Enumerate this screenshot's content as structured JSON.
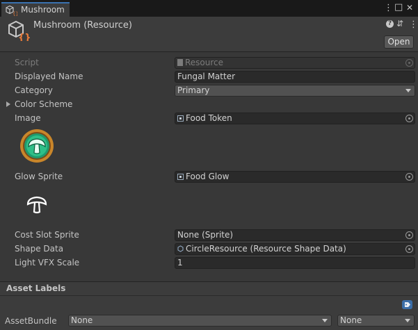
{
  "tab": {
    "title": "Mushroom",
    "icon": "scriptable-object-icon"
  },
  "window_controls": {
    "menu": "⋮",
    "maximize": "□",
    "close": "✕"
  },
  "header": {
    "title": "Mushroom (Resource)",
    "icons": [
      "help-icon",
      "presets-icon",
      "kebab-menu-icon"
    ],
    "help_glyph": "?",
    "presets_glyph": "⇵",
    "kebab_glyph": "⋮",
    "open_label": "Open"
  },
  "fields": {
    "script": {
      "label": "Script",
      "value": "Resource"
    },
    "displayed_name": {
      "label": "Displayed Name",
      "value": "Fungal Matter"
    },
    "category": {
      "label": "Category",
      "value": "Primary"
    },
    "color_scheme": {
      "label": "Color Scheme"
    },
    "image": {
      "label": "Image",
      "value": "Food Token"
    },
    "glow_sprite": {
      "label": "Glow Sprite",
      "value": "Food Glow"
    },
    "cost_slot_sprite": {
      "label": "Cost Slot Sprite",
      "value": "None (Sprite)"
    },
    "shape_data": {
      "label": "Shape Data",
      "value": "CircleResource (Resource Shape Data)"
    },
    "light_vfx_scale": {
      "label": "Light VFX Scale",
      "value": "1"
    }
  },
  "asset_labels": {
    "title": "Asset Labels"
  },
  "asset_bundle": {
    "label": "AssetBundle",
    "name_value": "None",
    "variant_value": "None"
  },
  "colors": {
    "accent": "#3a72b0",
    "token_gold": "#c9862a",
    "token_green": "#1f9a6e"
  }
}
